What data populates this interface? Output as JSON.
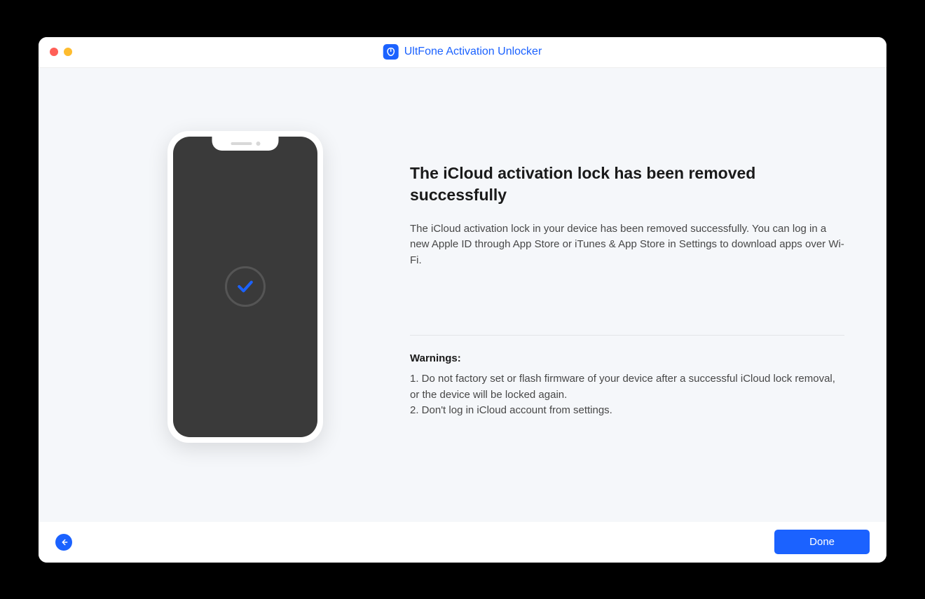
{
  "app": {
    "title": "UltFone Activation Unlocker"
  },
  "main": {
    "heading": "The iCloud activation lock has been removed successfully",
    "description": "The iCloud activation lock in your device has been removed successfully. You can log in a new Apple ID through App Store or iTunes & App Store in Settings to download apps over Wi-Fi.",
    "warnings_title": "Warnings:",
    "warning_1": "1. Do not factory set or flash firmware of your device after a successful iCloud lock removal, or the device will be locked again.",
    "warning_2": "2. Don't log in iCloud account from settings."
  },
  "footer": {
    "done_label": "Done"
  }
}
